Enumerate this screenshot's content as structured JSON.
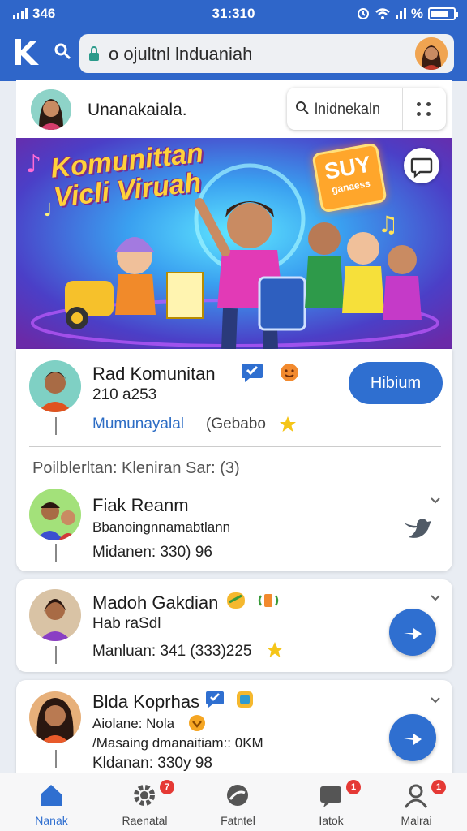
{
  "status_bar": {
    "left": "346",
    "time": "31:310",
    "right": "%"
  },
  "browser": {
    "url": "o ojultnl lnduaniah",
    "logo_icon": "app-logo-icon",
    "search_icon": "search-icon",
    "lock_icon": "lock-icon"
  },
  "community": {
    "name": "Unanakaiala.",
    "search_placeholder": "lnidnekaln",
    "banner_title_line1": "Komunittan",
    "banner_title_line2": "Vicli Viruah",
    "banner_badge_big": "SUY",
    "banner_badge_small": "ganaess"
  },
  "top_card": {
    "name": "Rad Komunitan",
    "number": "210 a253",
    "link": "Mumunayalal",
    "tag": "(Gebabo",
    "button": "Hibium"
  },
  "section_title": "Poilblerltan: Kleniran Sar: (3)",
  "members": [
    {
      "name": "Fiak Reanm",
      "line1": "Bbanoingnnamabtlann",
      "line2": "Midanen: 330) 96"
    },
    {
      "name": "Madoh Gakdian",
      "line1": "Hab raSdl",
      "line2": "Manluan: 341 (333)225"
    },
    {
      "name": "Blda Koprhas",
      "line1": "Aiolane: Nola",
      "line2": "/Masaing dmanaitiam:: 0KM",
      "line3": "Kldanan: 330y 98"
    }
  ],
  "nav": [
    {
      "label": "Nanak",
      "badge": ""
    },
    {
      "label": "Raenatal",
      "badge": "7"
    },
    {
      "label": "Fatntel",
      "badge": ""
    },
    {
      "label": "Iatok",
      "badge": "1"
    },
    {
      "label": "Malrai",
      "badge": "1"
    }
  ],
  "colors": {
    "primary": "#2f66c9",
    "button": "#2f6fd0",
    "badge": "#e53935"
  }
}
